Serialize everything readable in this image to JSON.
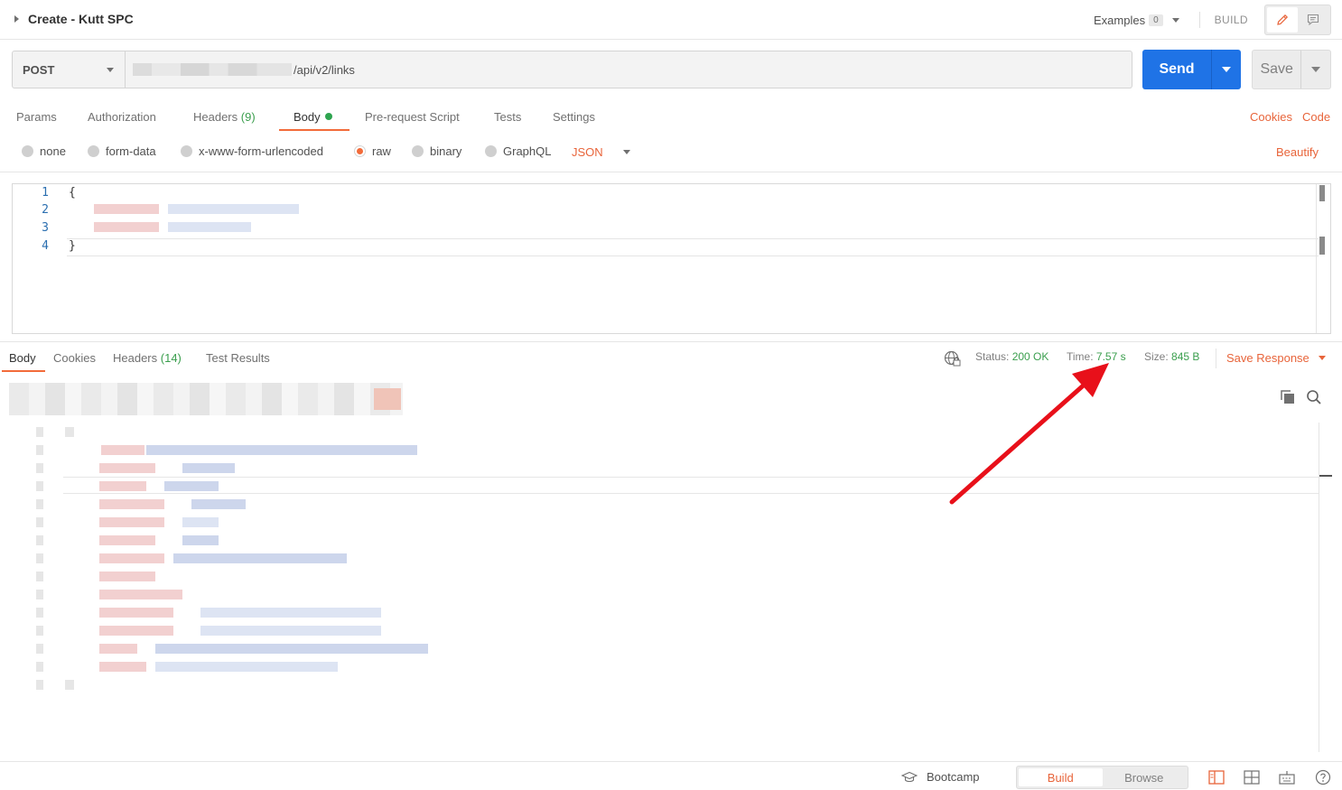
{
  "header": {
    "title": "Create - Kutt SPC",
    "examples_label": "Examples",
    "examples_count": "0",
    "build_label": "BUILD"
  },
  "request": {
    "method": "POST",
    "url_visible": "/api/v2/links",
    "send_label": "Send",
    "save_label": "Save"
  },
  "request_tabs": {
    "params": "Params",
    "authorization": "Authorization",
    "headers": "Headers",
    "headers_count": "(9)",
    "body": "Body",
    "pre_request": "Pre-request Script",
    "tests": "Tests",
    "settings": "Settings",
    "cookies": "Cookies",
    "code": "Code"
  },
  "body_modes": {
    "none": "none",
    "form_data": "form-data",
    "urlencoded": "x-www-form-urlencoded",
    "raw": "raw",
    "binary": "binary",
    "graphql": "GraphQL",
    "format": "JSON",
    "beautify": "Beautify",
    "selected": "raw"
  },
  "editor": {
    "line_numbers": [
      "1",
      "2",
      "3",
      "4"
    ],
    "line1": "{",
    "line4": "}"
  },
  "response_tabs": {
    "body": "Body",
    "cookies": "Cookies",
    "headers": "Headers",
    "headers_count": "(14)",
    "test_results": "Test Results"
  },
  "response_meta": {
    "status_label": "Status:",
    "status_value": "200 OK",
    "time_label": "Time:",
    "time_value": "7.57 s",
    "size_label": "Size:",
    "size_value": "845 B",
    "save_response": "Save Response"
  },
  "footer": {
    "bootcamp": "Bootcamp",
    "build": "Build",
    "browse": "Browse"
  },
  "colors": {
    "accent_orange": "#f26b3a",
    "send_blue": "#1f73e6",
    "success_green": "#3a9e4d",
    "annotation_red": "#e8101a"
  },
  "icons": [
    "pencil-icon",
    "comment-icon",
    "globe-lock-icon",
    "copy-icon",
    "search-icon",
    "graduation-cap-icon",
    "two-pane-icon",
    "grid-icon",
    "keyboard-icon",
    "help-icon"
  ]
}
